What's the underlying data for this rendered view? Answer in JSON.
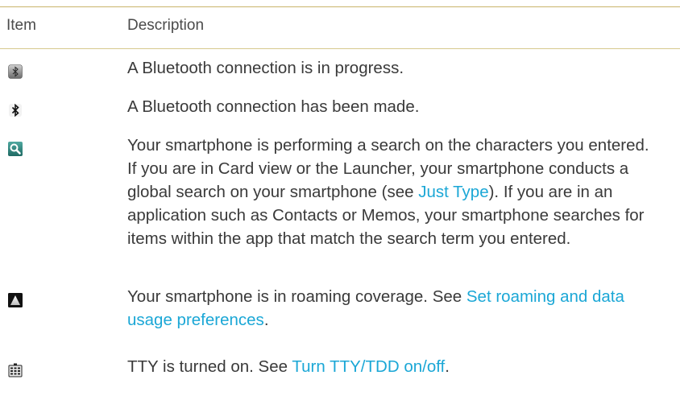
{
  "header": {
    "item": "Item",
    "description": "Description"
  },
  "rows": [
    {
      "icon": "bluetooth-connecting-icon",
      "text": "A Bluetooth connection is in progress."
    },
    {
      "icon": "bluetooth-connected-icon",
      "text": "A Bluetooth connection has been made."
    },
    {
      "icon": "search-icon",
      "text_before": "Your smartphone is performing a search on the characters you entered. If you are in Card view or the Launcher, your smartphone conducts a global search on your smartphone (see ",
      "link": "Just Type",
      "text_after": "). If you are in an application such as Contacts or Memos, your smartphone searches for items within the app that match the search term you entered."
    },
    {
      "icon": "roaming-icon",
      "text_before": "Your smartphone is in roaming coverage. See ",
      "link": "Set roaming and data usage preferences",
      "text_after": "."
    },
    {
      "icon": "tty-icon",
      "text_before": "TTY is turned on. See ",
      "link": "Turn TTY/TDD on/off",
      "text_after": "."
    }
  ],
  "colors": {
    "link": "#1ba7d6",
    "rule": "#c9b46a",
    "text": "#3a3a3a"
  }
}
